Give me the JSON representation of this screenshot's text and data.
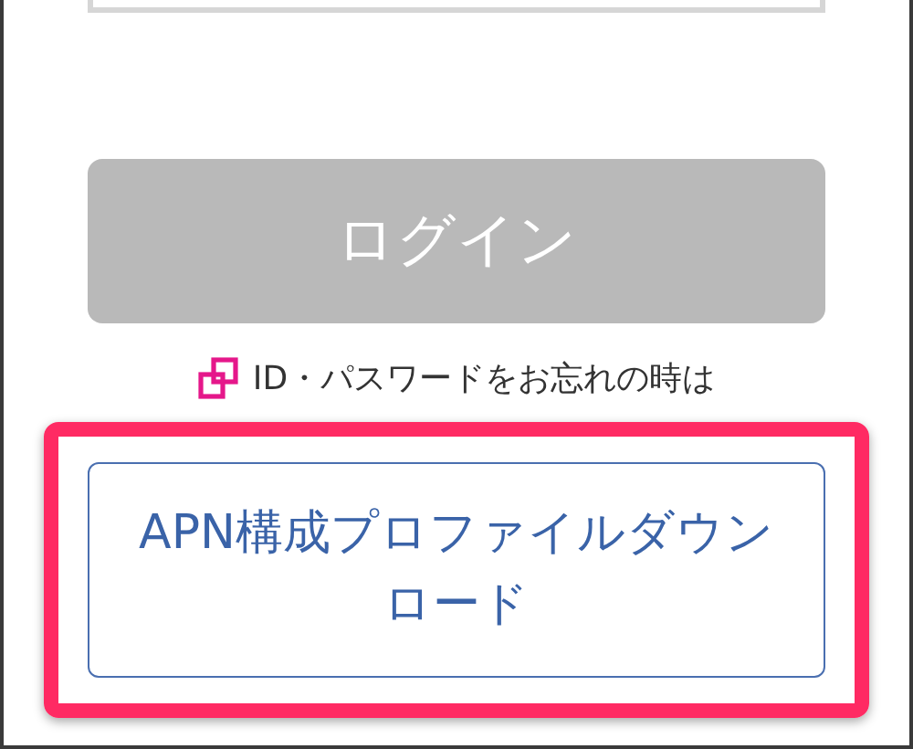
{
  "login_button": {
    "label": "ログイン",
    "disabled": true
  },
  "forgot_link": {
    "label": "ID・パスワードをお忘れの時は"
  },
  "apn_button": {
    "label": "APN構成プロファイルダウンロード",
    "highlighted": true
  }
}
